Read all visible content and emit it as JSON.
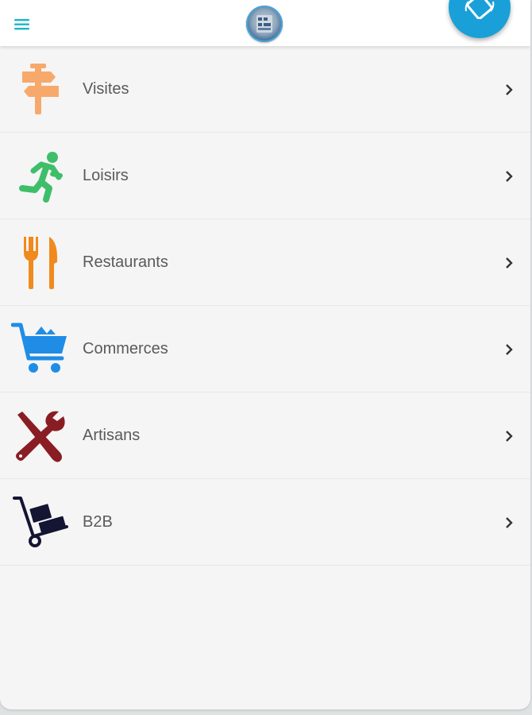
{
  "header": {
    "menu_icon": "hamburger-menu-icon",
    "logo_icon": "app-logo",
    "rotate_icon": "screen-rotation-icon"
  },
  "categories": [
    {
      "label": "Visites",
      "icon": "signpost-icon",
      "color": "#f7a96b"
    },
    {
      "label": "Loisirs",
      "icon": "running-person-icon",
      "color": "#3fbe6a"
    },
    {
      "label": "Restaurants",
      "icon": "fork-knife-icon",
      "color": "#f08a1e"
    },
    {
      "label": "Commerces",
      "icon": "shopping-cart-icon",
      "color": "#1f8de6"
    },
    {
      "label": "Artisans",
      "icon": "tools-icon",
      "color": "#8a1c24"
    },
    {
      "label": "B2B",
      "icon": "hand-truck-icon",
      "color": "#141433"
    }
  ],
  "colors": {
    "accent": "#1aa0d8",
    "menu_icon": "#19b5c9",
    "background": "#f5f5f5",
    "label_text": "#5a5a5a"
  }
}
